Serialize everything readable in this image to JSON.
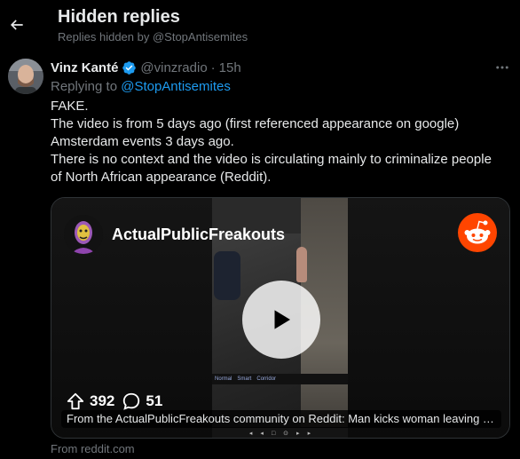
{
  "header": {
    "title": "Hidden replies",
    "subtitle": "Replies hidden by @StopAntisemites"
  },
  "tweet": {
    "display_name": "Vinz Kanté",
    "handle": "@vinzradio",
    "separator": "·",
    "time": "15h",
    "replying_prefix": "Replying to",
    "replying_to": "@StopAntisemites",
    "lines": [
      "FAKE.",
      "The video is from 5 days ago (first referenced appearance on google)",
      "Amsterdam events 3 days ago.",
      "There is no context and the video is circulating mainly to criminalize people",
      "of North African appearance (Reddit)."
    ]
  },
  "card": {
    "subreddit": "ActualPublicFreakouts",
    "upvotes": "392",
    "comments": "51",
    "caption": "From the ActualPublicFreakouts community on Reddit: Man kicks woman leaving a bar in Amsterdam",
    "video_tabs": [
      "Normal",
      "Smart",
      "Corridor"
    ],
    "from_text": "From reddit.com"
  },
  "colors": {
    "background": "#000000",
    "text": "#e7e9ea",
    "muted": "#71767b",
    "link": "#1d9bf0",
    "reddit_orange": "#ff4500"
  },
  "icons": {
    "back": "arrow-left-icon",
    "verified": "verified-badge-icon",
    "more": "more-horizontal-icon",
    "reddit": "reddit-logo-icon",
    "play": "play-icon",
    "upvote": "upvote-arrow-icon",
    "comment": "comment-bubble-icon"
  }
}
